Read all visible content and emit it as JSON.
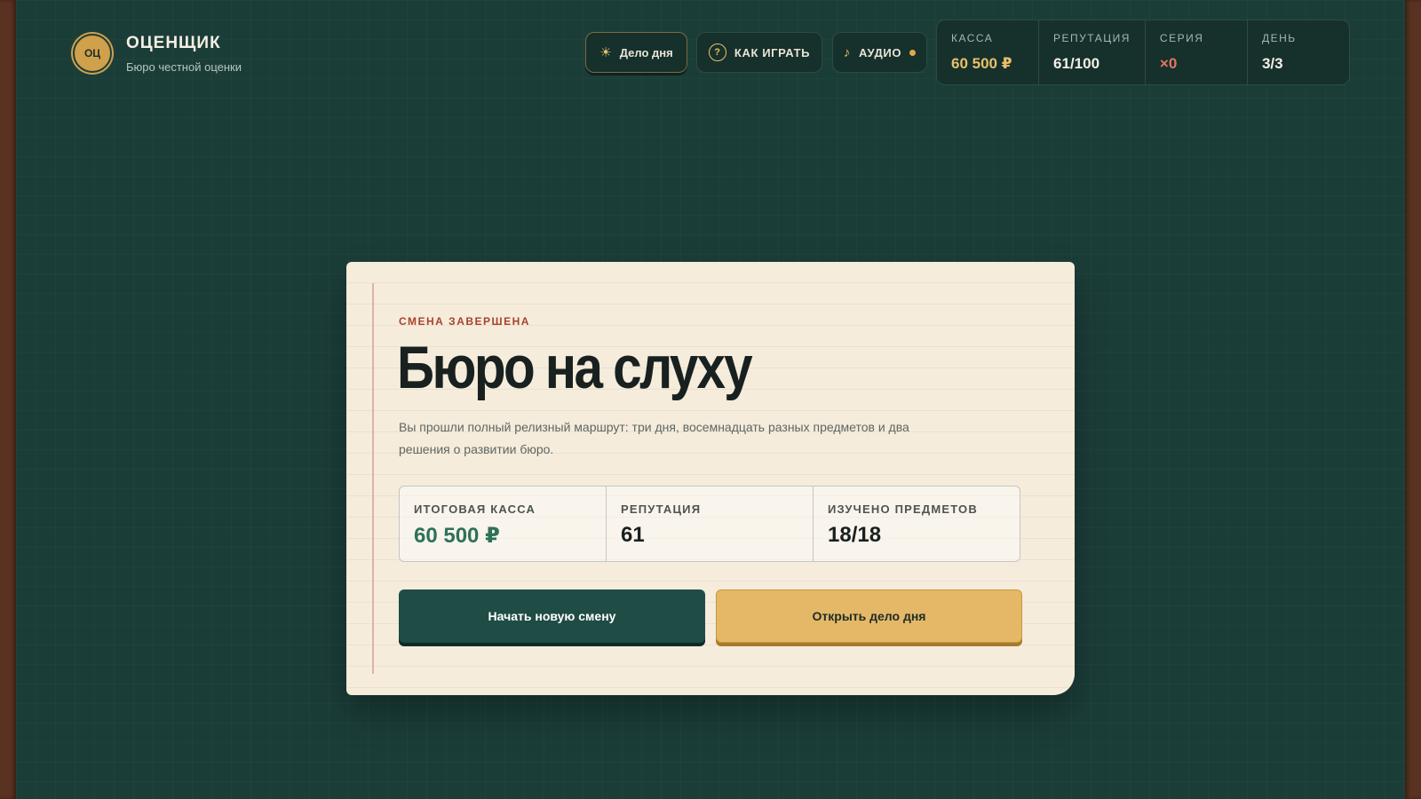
{
  "brand": {
    "logo_text": "ОЦ",
    "title": "ОЦЕНЩИК",
    "subtitle": "Бюро честной оценки"
  },
  "toolbar": {
    "day_case_label": "Дело дня",
    "how_to_play_label": "КАК ИГРАТЬ",
    "how_to_play_icon_text": "?",
    "audio_label": "АУДИО"
  },
  "stats": [
    {
      "label": "КАССА",
      "value": "60 500 ₽"
    },
    {
      "label": "РЕПУТАЦИЯ",
      "value": "61/100"
    },
    {
      "label": "СЕРИЯ",
      "value": "×0"
    },
    {
      "label": "ДЕНЬ",
      "value": "3/3"
    }
  ],
  "card": {
    "eyebrow": "СМЕНА ЗАВЕРШЕНА",
    "title": "Бюро на слуху",
    "description": "Вы прошли полный релизный маршрут: три дня, восемнадцать разных предметов и два решения о развитии бюро.",
    "results": [
      {
        "label": "ИТОГОВАЯ КАССА",
        "value": "60 500 ₽"
      },
      {
        "label": "РЕПУТАЦИЯ",
        "value": "61"
      },
      {
        "label": "ИЗУЧЕНО ПРЕДМЕТОВ",
        "value": "18/18"
      }
    ],
    "primary_button": "Начать новую смену",
    "secondary_button": "Открыть дело дня"
  },
  "icons": {
    "day_case": "sun-icon",
    "how_to_play": "question-icon",
    "audio": "music-note-icon",
    "audio_status": "status-dot-icon"
  },
  "colors": {
    "board": "#1b3d38",
    "frame": "#5a3221",
    "gold_accent": "#e9c06a",
    "streak_red": "#e47561",
    "paper": "#f5ecdc",
    "primary_button": "#1f4c45",
    "secondary_button": "#e4b866",
    "cash_green": "#2d7259"
  }
}
